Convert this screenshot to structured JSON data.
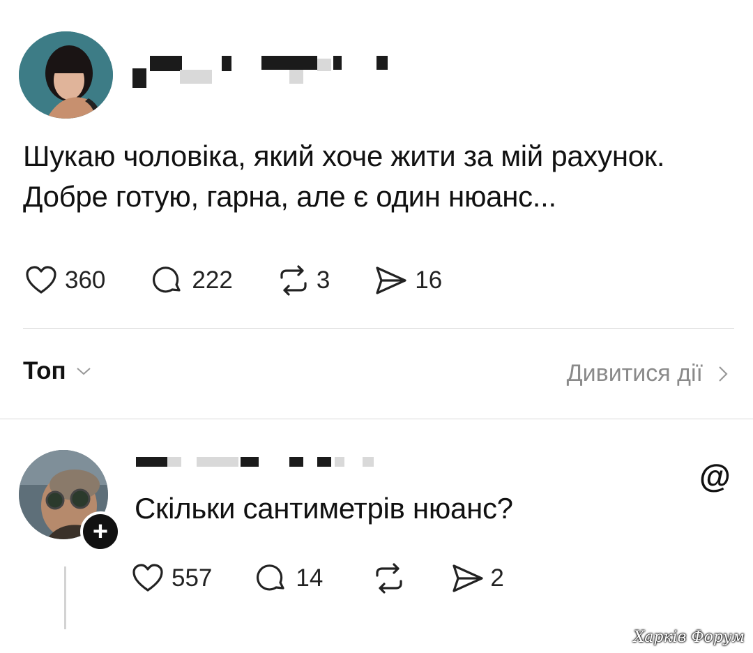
{
  "post": {
    "text_line1": "Шукаю чоловіка, який хоче жити за мій рахунок.",
    "text_line2": "Добре готую, гарна, але є один нюанс...",
    "likes": "360",
    "comments": "222",
    "reposts": "3",
    "shares": "16"
  },
  "replies_header": {
    "sort_label": "Топ",
    "view_activity_label": "Дивитися дії"
  },
  "reply": {
    "text": "Скільки сантиметрів нюанс?",
    "likes": "557",
    "comments": "14",
    "reposts": "",
    "shares": "2",
    "follow_symbol": "+",
    "app_logo": "@"
  },
  "watermark": "Харків Форум",
  "icons": [
    "heart-icon",
    "comment-icon",
    "repost-icon",
    "share-icon",
    "chevron-down-icon",
    "chevron-right-icon",
    "threads-logo-icon",
    "plus-icon"
  ]
}
